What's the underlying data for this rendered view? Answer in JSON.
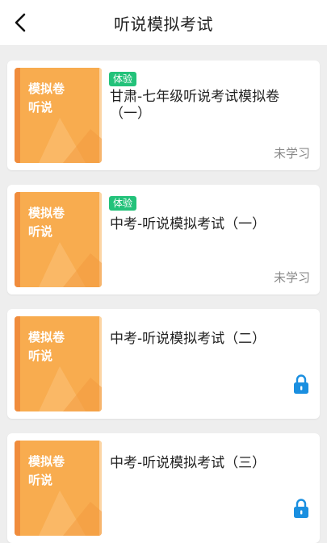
{
  "header": {
    "title": "听说模拟考试"
  },
  "cover": {
    "line1": "模拟卷",
    "line2": "听说"
  },
  "items": [
    {
      "badge": "体验",
      "name": "甘肃-七年级听说考试模拟卷（一）",
      "status": "未学习",
      "locked": false
    },
    {
      "badge": "体验",
      "name": "中考-听说模拟考试（一）",
      "status": "未学习",
      "locked": false
    },
    {
      "badge": "",
      "name": "中考-听说模拟考试（二）",
      "status": "",
      "locked": true
    },
    {
      "badge": "",
      "name": "中考-听说模拟考试（三）",
      "status": "",
      "locked": true
    }
  ],
  "colors": {
    "cover": "#f8ac4f",
    "badge": "#23c27a",
    "lock": "#1a8fe0"
  }
}
